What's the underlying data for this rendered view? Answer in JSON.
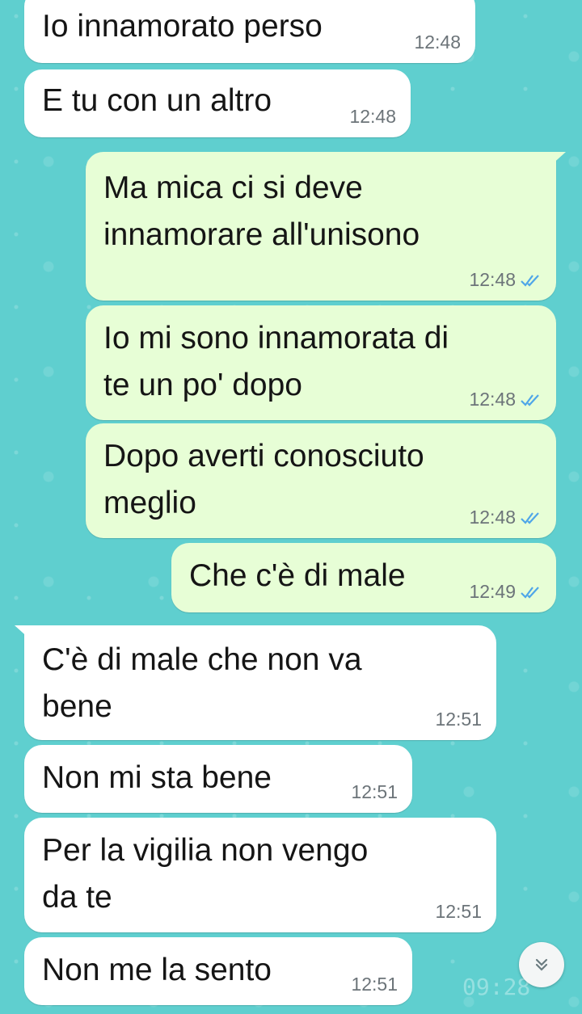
{
  "chat": {
    "messages": [
      {
        "dir": "in",
        "text": "Io innamorato perso",
        "time": "12:48"
      },
      {
        "dir": "in",
        "text": "E tu con un altro",
        "time": "12:48"
      },
      {
        "dir": "out",
        "text": "Ma mica ci si deve\ninnamorare all'unisono",
        "time": "12:48",
        "status": "read"
      },
      {
        "dir": "out",
        "text": "Io mi sono innamorata di\nte un po' dopo",
        "time": "12:48",
        "status": "read"
      },
      {
        "dir": "out",
        "text": "Dopo averti conosciuto\nmeglio",
        "time": "12:48",
        "status": "read"
      },
      {
        "dir": "out",
        "text": "Che c'è di male",
        "time": "12:49",
        "status": "read"
      },
      {
        "dir": "in",
        "text": "C'è di male che non va\nbene",
        "time": "12:51"
      },
      {
        "dir": "in",
        "text": "Non mi sta bene",
        "time": "12:51"
      },
      {
        "dir": "in",
        "text": "Per la vigilia non vengo\nda te",
        "time": "12:51"
      },
      {
        "dir": "in",
        "text": "Non me la sento",
        "time": "12:51"
      }
    ]
  },
  "scroll_button": {
    "icon": "double-chevron-down-icon"
  },
  "watermark": "09:28",
  "colors": {
    "wallpaper": "#5fcfcf",
    "incoming_bubble": "#ffffff",
    "outgoing_bubble": "#e7fed6",
    "read_ticks": "#4fa6e8"
  }
}
